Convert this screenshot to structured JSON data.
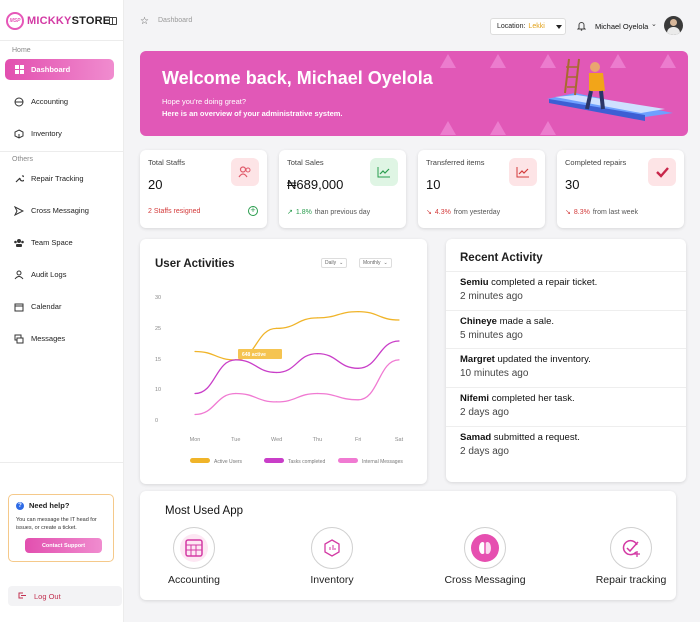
{
  "brand": {
    "logo_text": "MSP",
    "name_part1": "MICKKY",
    "name_part2": "STORE"
  },
  "sidebar": {
    "section_home": "Home",
    "section_others": "Others",
    "items": [
      {
        "label": "Dashboard",
        "icon": "grid-icon"
      },
      {
        "label": "Accounting",
        "icon": "cash-icon"
      },
      {
        "label": "Inventory",
        "icon": "box-icon"
      },
      {
        "label": "Repair Tracking",
        "icon": "wrench-icon"
      },
      {
        "label": "Cross Messaging",
        "icon": "send-icon"
      },
      {
        "label": "Team Space",
        "icon": "team-icon"
      },
      {
        "label": "Audit Logs",
        "icon": "user-log-icon"
      },
      {
        "label": "Calendar",
        "icon": "calendar-icon"
      },
      {
        "label": "Messages",
        "icon": "chat-icon"
      }
    ],
    "help": {
      "title": "Need help?",
      "text": "You can message the IT head for issues, or create a ticket.",
      "button": "Contact Support"
    },
    "logout": "Log Out"
  },
  "topbar": {
    "breadcrumb": "Dashboard",
    "location_label": "Location:",
    "location_value": "Lekki",
    "user_name": "Michael Oyelola"
  },
  "banner": {
    "title": "Welcome back, Michael Oyelola",
    "subtitle": "Hope you're doing great?",
    "subtitle2": "Here is an overview of your administrative system."
  },
  "stats": [
    {
      "label": "Total Staffs",
      "value": "20",
      "foot": "2 Staffs resigned",
      "foot_color": "#d33a3a",
      "icon": "people-icon",
      "icon_bg": "#fde4e6"
    },
    {
      "label": "Total Sales",
      "value": "₦689,000",
      "trend": "1.8%",
      "foot": "than previous day",
      "trend_color": "#2a9d4e",
      "icon": "chart-up-icon",
      "icon_bg": "#dff5e4"
    },
    {
      "label": "Transferred items",
      "value": "10",
      "trend": "4.3%",
      "foot": "from yesterday",
      "trend_color": "#d33a3a",
      "icon": "chart-up-icon",
      "icon_bg": "#fde4e6"
    },
    {
      "label": "Completed repairs",
      "value": "30",
      "trend": "8.3%",
      "foot": "from last week",
      "trend_color": "#d33a3a",
      "icon": "check-icon",
      "icon_bg": "#fde4e6"
    }
  ],
  "user_activities": {
    "title": "User Activities",
    "filter_daily": "Daily",
    "filter_monthly": "Monthly",
    "tooltip": "648 active"
  },
  "chart_data": {
    "type": "line",
    "title": "User Activities",
    "x": [
      "Mon",
      "Tue",
      "Wed",
      "Thu",
      "Fri",
      "Sat"
    ],
    "y_ticks": [
      "0",
      "10",
      "15",
      "25",
      "30"
    ],
    "series": [
      {
        "name": "Active Users",
        "color": "#f0b429",
        "values": [
          17.5,
          15.5,
          23,
          25.5,
          27,
          25
        ]
      },
      {
        "name": "Tasks completed",
        "color": "#c93ec8",
        "values": [
          7.5,
          15.5,
          12.5,
          17,
          13.5,
          20
        ]
      },
      {
        "name": "Internal Messages",
        "color": "#f07ad2",
        "values": [
          2.5,
          7.5,
          5.5,
          7.5,
          6,
          15.5
        ]
      }
    ]
  },
  "recent": {
    "title": "Recent Activity",
    "items": [
      {
        "name": "Semiu",
        "action": "completed a repair ticket.",
        "time": "2 minutes ago"
      },
      {
        "name": "Chineye",
        "action": "made a sale.",
        "time": "5 minutes ago"
      },
      {
        "name": "Margret",
        "action": "updated the inventory.",
        "time": "10 minutes ago"
      },
      {
        "name": "Nifemi",
        "action": "completed her task.",
        "time": "2 days ago"
      },
      {
        "name": "Samad",
        "action": "submitted a request.",
        "time": "2 days ago"
      }
    ]
  },
  "most_used": {
    "title": "Most Used App",
    "apps": [
      {
        "label": "Accounting",
        "icon": "calculator-icon",
        "bg": "#fde7f3"
      },
      {
        "label": "Inventory",
        "icon": "inventory-icon",
        "bg": "#fff"
      },
      {
        "label": "Cross Messaging",
        "icon": "messaging-icon",
        "bg": "#e64fb0"
      },
      {
        "label": "Repair tracking",
        "icon": "repair-check-icon",
        "bg": "#fff"
      }
    ]
  }
}
